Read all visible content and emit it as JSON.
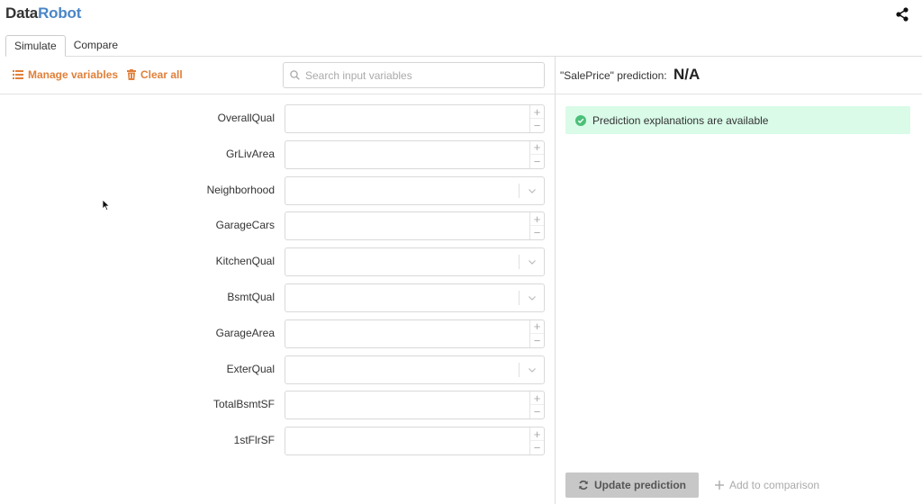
{
  "app": {
    "logo_part1": "Data",
    "logo_part2": "Robot",
    "share_icon": "share-icon"
  },
  "tabs": [
    {
      "label": "Simulate",
      "active": true
    },
    {
      "label": "Compare",
      "active": false
    }
  ],
  "toolbar": {
    "manage_label": "Manage variables",
    "clear_label": "Clear all",
    "search_placeholder": "Search input variables",
    "search_value": ""
  },
  "fields": [
    {
      "label": "OverallQual",
      "type": "number",
      "value": ""
    },
    {
      "label": "GrLivArea",
      "type": "number",
      "value": ""
    },
    {
      "label": "Neighborhood",
      "type": "select",
      "value": ""
    },
    {
      "label": "GarageCars",
      "type": "number",
      "value": ""
    },
    {
      "label": "KitchenQual",
      "type": "select",
      "value": ""
    },
    {
      "label": "BsmtQual",
      "type": "select",
      "value": ""
    },
    {
      "label": "GarageArea",
      "type": "number",
      "value": ""
    },
    {
      "label": "ExterQual",
      "type": "select",
      "value": ""
    },
    {
      "label": "TotalBsmtSF",
      "type": "number",
      "value": ""
    },
    {
      "label": "1stFlrSF",
      "type": "number",
      "value": ""
    }
  ],
  "prediction": {
    "label": "\"SalePrice\" prediction:",
    "value": "N/A",
    "banner_text": "Prediction explanations are available",
    "update_label": "Update prediction",
    "add_comparison_label": "Add to comparison"
  },
  "colors": {
    "accent": "#e0803a",
    "logo_blue": "#4a86c8",
    "success_bg": "#d9fbe8",
    "success_icon": "#4cc07a"
  }
}
